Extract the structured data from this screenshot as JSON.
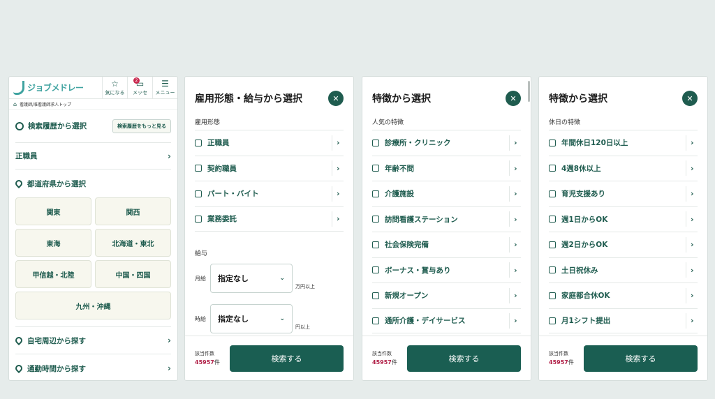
{
  "panel1": {
    "logo_text": "ジョブメドレー",
    "header_buttons": [
      {
        "label": "気になる",
        "icon": "star-icon"
      },
      {
        "label": "メッセ",
        "icon": "chat-icon",
        "badge": "2"
      },
      {
        "label": "メニュー",
        "icon": "hamburger-icon"
      }
    ],
    "breadcrumb": "看護師/准看護師求人トップ",
    "history_label": "検索履歴から選択",
    "history_more": "検索履歴をもっと見る",
    "fulltime_label": "正職員",
    "prefecture_label": "都道府県から選択",
    "regions": [
      "関東",
      "関西",
      "東海",
      "北海道・東北",
      "甲信越・北陸",
      "中国・四国",
      "九州・沖縄"
    ],
    "nearby_label": "自宅周辺から探す",
    "commute_label": "通勤時間から探す"
  },
  "panel2": {
    "title": "雇用形態・給与から選択",
    "employment_label": "雇用形態",
    "employment_options": [
      "正職員",
      "契約職員",
      "パート・バイト",
      "業務委託"
    ],
    "salary_label": "給与",
    "monthly_label": "月給",
    "monthly_value": "指定なし",
    "monthly_unit": "万円以上",
    "hourly_label": "時給",
    "hourly_value": "指定なし",
    "hourly_unit": "円以上"
  },
  "panel3": {
    "title": "特徴から選択",
    "section_label": "人気の特徴",
    "options": [
      "診療所・クリニック",
      "年齢不問",
      "介護施設",
      "訪問看護ステーション",
      "社会保険完備",
      "ボーナス・賞与あり",
      "新規オープン",
      "通所介護・デイサービス"
    ]
  },
  "panel4": {
    "title": "特徴から選択",
    "section_label": "休日の特徴",
    "options": [
      "年間休日120日以上",
      "4週8休以上",
      "育児支援あり",
      "週1日からOK",
      "週2日からOK",
      "土日祝休み",
      "家庭都合休OK",
      "月1シフト提出"
    ]
  },
  "footer": {
    "count_label": "該当件数",
    "count_value": "45957",
    "count_unit": "件",
    "search_label": "検索する"
  }
}
